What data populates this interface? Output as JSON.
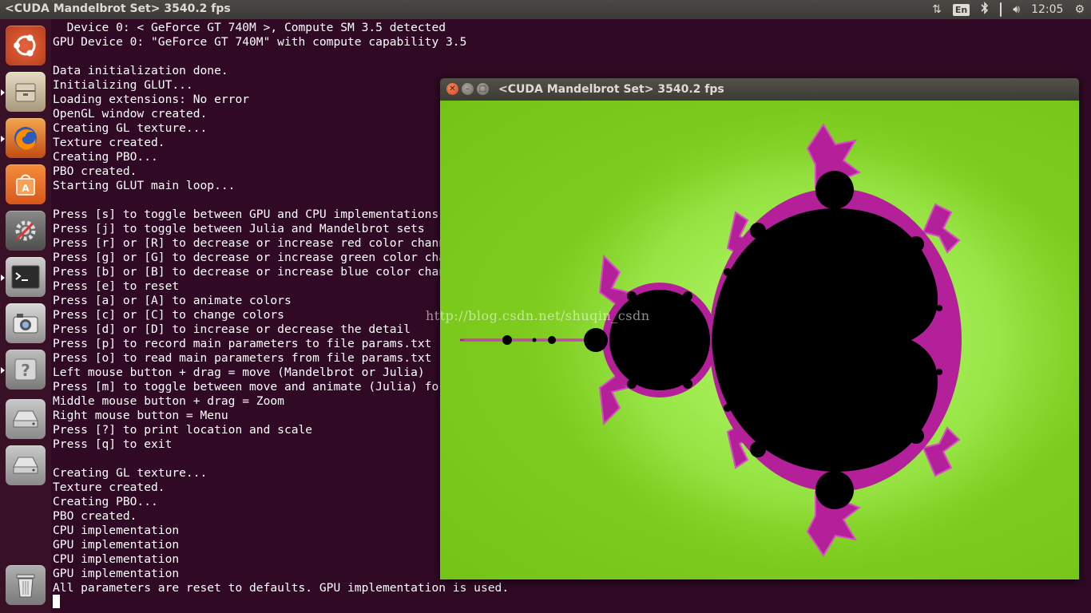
{
  "topbar": {
    "title": "<CUDA Mandelbrot Set> 3540.2 fps",
    "keyboard_layout": "En",
    "clock": "12:05"
  },
  "launcher": {
    "items": [
      {
        "name": "ubuntu-dash-icon",
        "color": "#d9532c"
      },
      {
        "name": "files-icon",
        "color": "#b9a98a"
      },
      {
        "name": "firefox-icon",
        "color": "#e66000"
      },
      {
        "name": "software-center-icon",
        "color": "#e9741e"
      },
      {
        "name": "system-settings-icon",
        "color": "#6d6d6d"
      },
      {
        "name": "terminal-icon",
        "color": "#3c3c3c"
      },
      {
        "name": "shotwell-icon",
        "color": "#9a9a9a"
      },
      {
        "name": "unknown-app-icon",
        "color": "#8a8a8a"
      },
      {
        "name": "drive-icon",
        "color": "#b0b0b0"
      },
      {
        "name": "drive-icon-2",
        "color": "#b0b0b0"
      },
      {
        "name": "trash-icon",
        "color": "#8a8a8a"
      }
    ]
  },
  "terminal": {
    "lines": [
      "  Device 0: < GeForce GT 740M >, Compute SM 3.5 detected",
      "GPU Device 0: \"GeForce GT 740M\" with compute capability 3.5",
      "",
      "Data initialization done.",
      "Initializing GLUT...",
      "Loading extensions: No error",
      "OpenGL window created.",
      "Creating GL texture...",
      "Texture created.",
      "Creating PBO...",
      "PBO created.",
      "Starting GLUT main loop...",
      "",
      "Press [s] to toggle between GPU and CPU implementations",
      "Press [j] to toggle between Julia and Mandelbrot sets",
      "Press [r] or [R] to decrease or increase red color channel",
      "Press [g] or [G] to decrease or increase green color channel",
      "Press [b] or [B] to decrease or increase blue color channel",
      "Press [e] to reset",
      "Press [a] or [A] to animate colors",
      "Press [c] or [C] to change colors",
      "Press [d] or [D] to increase or decrease the detail",
      "Press [p] to record main parameters to file params.txt",
      "Press [o] to read main parameters from file params.txt",
      "Left mouse button + drag = move (Mandelbrot or Julia)",
      "Press [m] to toggle between move and animate (Julia) for mouse",
      "Middle mouse button + drag = Zoom",
      "Right mouse button = Menu",
      "Press [?] to print location and scale",
      "Press [q] to exit",
      "",
      "Creating GL texture...",
      "Texture created.",
      "Creating PBO...",
      "PBO created.",
      "CPU implementation",
      "GPU implementation",
      "CPU implementation",
      "GPU implementation",
      "All parameters are reset to defaults. GPU implementation is used."
    ]
  },
  "watermark": "http://blog.csdn.net/shuqin_csdn",
  "gl_window": {
    "title": "<CUDA Mandelbrot Set> 3540.2 fps"
  }
}
